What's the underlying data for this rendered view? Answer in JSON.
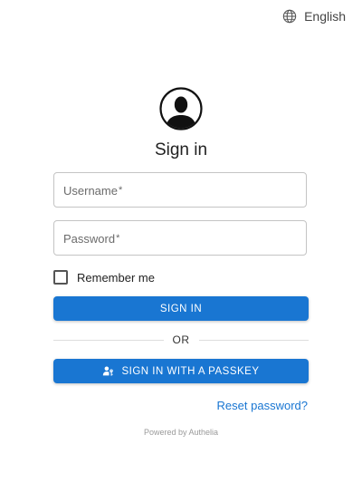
{
  "header": {
    "language_label": "English",
    "language_icon": "globe-icon"
  },
  "avatar": {
    "icon": "user-avatar-icon"
  },
  "form": {
    "title": "Sign in",
    "username": {
      "label": "Username",
      "required_mark": "*",
      "value": ""
    },
    "password": {
      "label": "Password",
      "required_mark": "*",
      "value": ""
    },
    "remember_me": {
      "label": "Remember me",
      "checked": false
    },
    "sign_in_label": "SIGN IN",
    "divider_label": "OR",
    "passkey_label": "SIGN IN WITH A PASSKEY",
    "passkey_icon": "passkey-icon",
    "reset_password_label": "Reset password?"
  },
  "footer": {
    "powered_by": "Powered by Authelia"
  },
  "colors": {
    "primary": "#1976d2",
    "border": "#c4c4c4",
    "muted_text": "#9a9a9a"
  }
}
